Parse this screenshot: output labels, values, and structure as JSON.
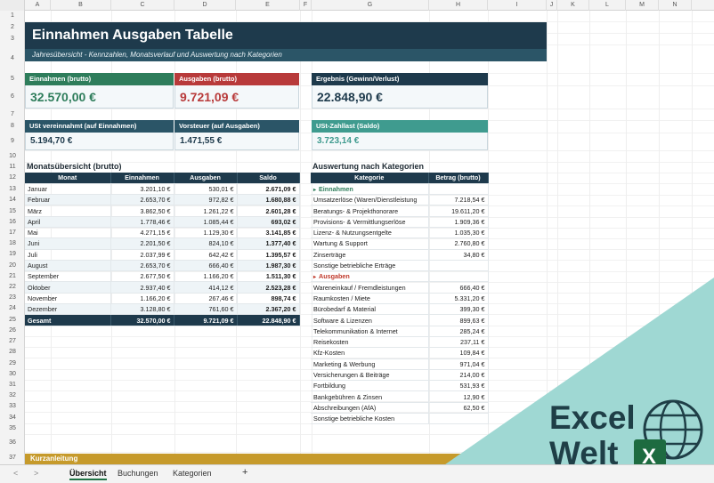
{
  "columns": [
    "A",
    "B",
    "C",
    "D",
    "E",
    "F",
    "G",
    "H",
    "I",
    "J",
    "K",
    "L",
    "M",
    "N"
  ],
  "rows": [
    "1",
    "2",
    "3",
    "4",
    "5",
    "6",
    "7",
    "8",
    "9",
    "10",
    "11",
    "12",
    "13",
    "14",
    "15",
    "16",
    "17",
    "18",
    "19",
    "20",
    "21",
    "22",
    "23",
    "24",
    "25",
    "26",
    "27",
    "28",
    "29",
    "30",
    "31",
    "32",
    "33",
    "34",
    "35",
    "36",
    "37"
  ],
  "title": "Einnahmen Ausgaben Tabelle",
  "subtitle": "Jahresübersicht - Kennzahlen, Monatsverlauf und Auswertung nach Kategorien",
  "kpi": {
    "income_label": "Einnahmen (brutto)",
    "income_value": "32.570,00 €",
    "expense_label": "Ausgaben (brutto)",
    "expense_value": "9.721,09 €",
    "result_label": "Ergebnis (Gewinn/Verlust)",
    "result_value": "22.848,90 €",
    "ust_label": "USt vereinnahmt (auf Einnahmen)",
    "ust_value": "5.194,70 €",
    "vorsteuer_label": "Vorsteuer (auf Ausgaben)",
    "vorsteuer_value": "1.471,55 €",
    "zahllast_label": "USt-Zahllast (Saldo)",
    "zahllast_value": "3.723,14 €"
  },
  "colors": {
    "navy": "#1e3a4c",
    "green": "#2e7d5b",
    "red": "#b83a3a",
    "teal": "#3f9b8f",
    "gold": "#c69a2b",
    "logo_bg": "#9fd8d3"
  },
  "monthly": {
    "title": "Monatsübersicht (brutto)",
    "headers": [
      "Monat",
      "Einnahmen",
      "Ausgaben",
      "Saldo"
    ],
    "rows": [
      [
        "Januar",
        "3.201,10 €",
        "530,01 €",
        "2.671,09 €"
      ],
      [
        "Februar",
        "2.653,70 €",
        "972,82 €",
        "1.680,88 €"
      ],
      [
        "März",
        "3.862,50 €",
        "1.261,22 €",
        "2.601,28 €"
      ],
      [
        "April",
        "1.778,46 €",
        "1.085,44 €",
        "693,02 €"
      ],
      [
        "Mai",
        "4.271,15 €",
        "1.129,30 €",
        "3.141,85 €"
      ],
      [
        "Juni",
        "2.201,50 €",
        "824,10 €",
        "1.377,40 €"
      ],
      [
        "Juli",
        "2.037,99 €",
        "642,42 €",
        "1.395,57 €"
      ],
      [
        "August",
        "2.653,70 €",
        "666,40 €",
        "1.987,30 €"
      ],
      [
        "September",
        "2.677,50 €",
        "1.166,20 €",
        "1.511,30 €"
      ],
      [
        "Oktober",
        "2.937,40 €",
        "414,12 €",
        "2.523,28 €"
      ],
      [
        "November",
        "1.166,20 €",
        "267,46 €",
        "898,74 €"
      ],
      [
        "Dezember",
        "3.128,80 €",
        "761,60 €",
        "2.367,20 €"
      ]
    ],
    "total": [
      "Gesamt",
      "32.570,00 €",
      "9.721,09 €",
      "22.848,90 €"
    ]
  },
  "categories": {
    "title": "Auswertung nach Kategorien",
    "headers": [
      "Kategorie",
      "Betrag (brutto)"
    ],
    "income_group": "Einnahmen",
    "income_rows": [
      [
        "Umsatzerlöse (Waren/Dienstleistung",
        "7.218,54 €"
      ],
      [
        "Beratungs- & Projekthonorare",
        "19.611,20 €"
      ],
      [
        "Provisions- & Vermittlungserlöse",
        "1.909,36 €"
      ],
      [
        "Lizenz- & Nutzungsentgelte",
        "1.035,30 €"
      ],
      [
        "Wartung & Support",
        "2.760,80 €"
      ],
      [
        "Zinserträge",
        "34,80 €"
      ],
      [
        "Sonstige betriebliche Erträge",
        ""
      ]
    ],
    "expense_group": "Ausgaben",
    "expense_rows": [
      [
        "Wareneinkauf / Fremdleistungen",
        "666,40 €"
      ],
      [
        "Raumkosten / Miete",
        "5.331,20 €"
      ],
      [
        "Bürobedarf & Material",
        "399,30 €"
      ],
      [
        "Software & Lizenzen",
        "899,63 €"
      ],
      [
        "Telekommunikation & Internet",
        "285,24 €"
      ],
      [
        "Reisekosten",
        "237,11 €"
      ],
      [
        "Kfz-Kosten",
        "109,84 €"
      ],
      [
        "Marketing & Werbung",
        "971,04 €"
      ],
      [
        "Versicherungen & Beiträge",
        "214,00 €"
      ],
      [
        "Fortbildung",
        "531,93 €"
      ],
      [
        "Bankgebühren & Zinsen",
        "12,90 €"
      ],
      [
        "Abschreibungen (AfA)",
        "62,50 €"
      ],
      [
        "Sonstige betriebliche Kosten",
        ""
      ]
    ]
  },
  "kurzanleitung": "Kurzanleitung",
  "tabs": [
    "Übersicht",
    "Buchungen",
    "Kategorien"
  ],
  "tab_add": "+",
  "nav_prev": "<",
  "nav_next": ">",
  "logo": {
    "line1": "Excel",
    "line2": "Welt",
    "badge": "X"
  }
}
